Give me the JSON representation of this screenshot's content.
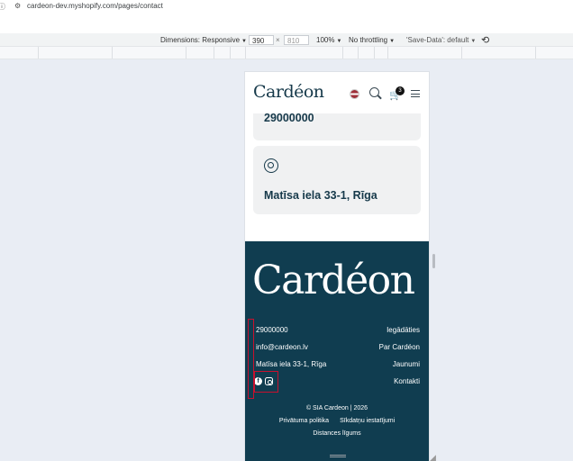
{
  "browser": {
    "url": "cardeon-dev.myshopify.com/pages/contact"
  },
  "devtools": {
    "dimensions_label": "Dimensions: Responsive",
    "width": "390",
    "times": "×",
    "height": "810",
    "zoom": "100%",
    "throttling": "No throttling",
    "save_data": "'Save-Data': default"
  },
  "header": {
    "logo": "Cardéon",
    "cart_count": "3"
  },
  "contact_cards": {
    "phone": "29000000",
    "address": "Matīsa iela 33-1, Rīga"
  },
  "footer": {
    "logo": "Cardéon",
    "contacts": [
      "29000000",
      "info@cardeon.lv",
      "Matīsa iela 33-1, Rīga"
    ],
    "links": [
      "Iegādāties",
      "Par Cardéon",
      "Jaunumi",
      "Kontakti"
    ],
    "copyright": "© SIA Cardeon | 2026",
    "legal": [
      "Privātuma politika",
      "Sīkdatņu iestatījumi",
      "Distances līgums"
    ]
  },
  "colors": {
    "footer_bg": "#103d50",
    "brand_text": "#16394a",
    "highlight": "#c8102e"
  }
}
